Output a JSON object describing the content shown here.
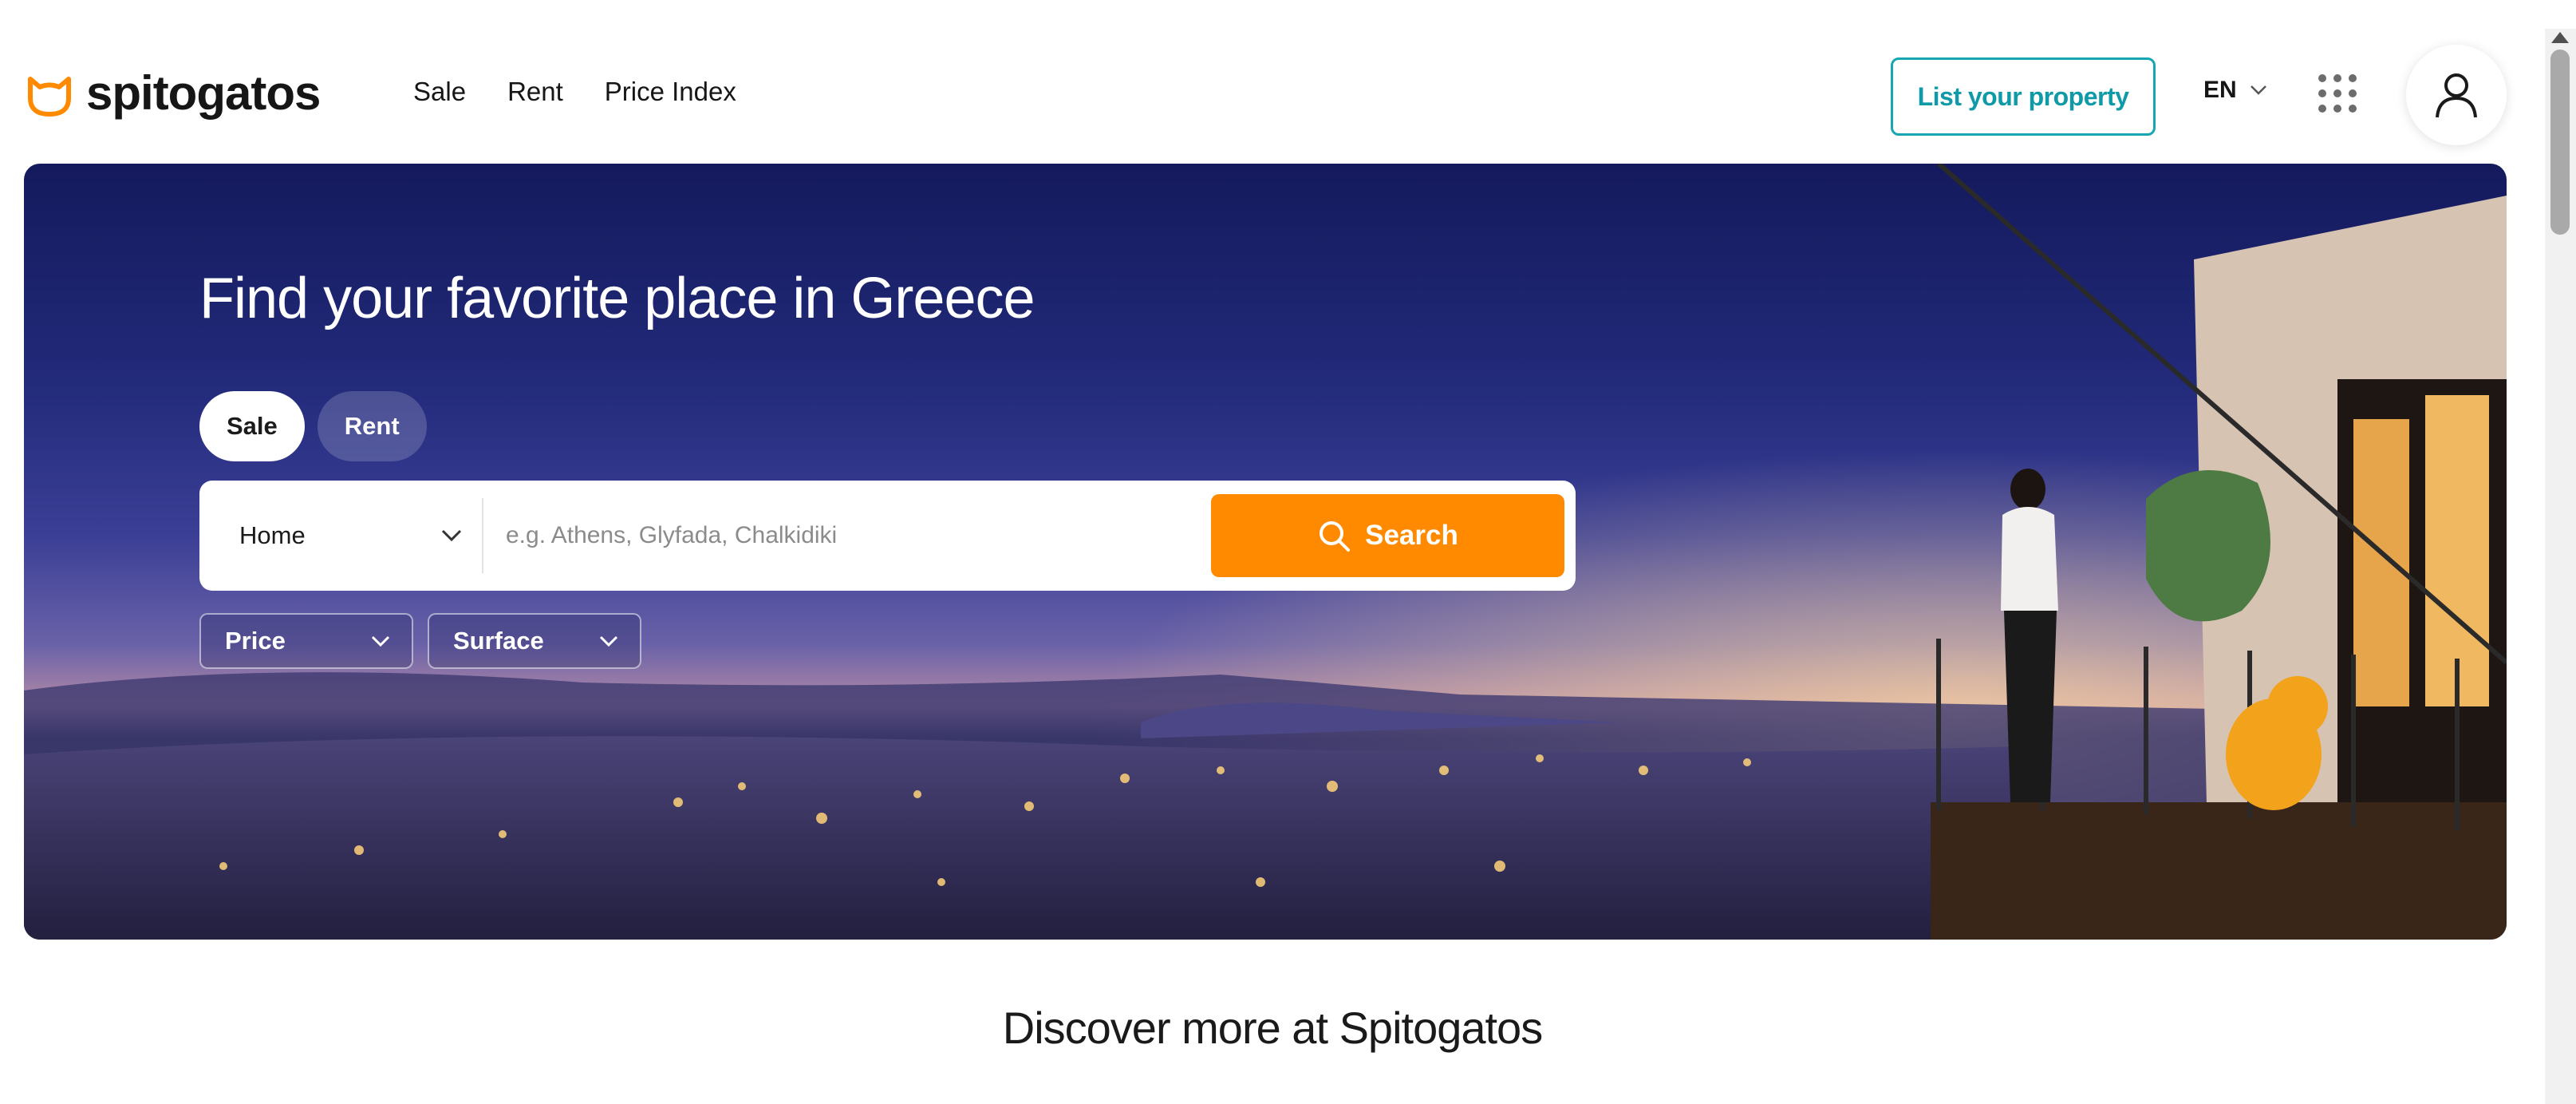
{
  "brand": {
    "name": "spitogatos",
    "accent": "#ff8a00",
    "teal": "#19a6b3"
  },
  "nav": {
    "items": [
      "Sale",
      "Rent",
      "Price Index"
    ]
  },
  "header": {
    "list_property": "List your property",
    "language": "EN",
    "apps_icon": "grid-icon",
    "user_icon": "user-icon"
  },
  "hero": {
    "title": "Find your favorite place in Greece",
    "tabs": {
      "active": "Sale",
      "inactive": "Rent"
    },
    "search": {
      "type_selected": "Home",
      "placeholder": "e.g. Athens, Glyfada, Chalkidiki",
      "button": "Search"
    },
    "filters": {
      "price": "Price",
      "surface": "Surface"
    }
  },
  "discover": {
    "title": "Discover more at Spitogatos"
  }
}
